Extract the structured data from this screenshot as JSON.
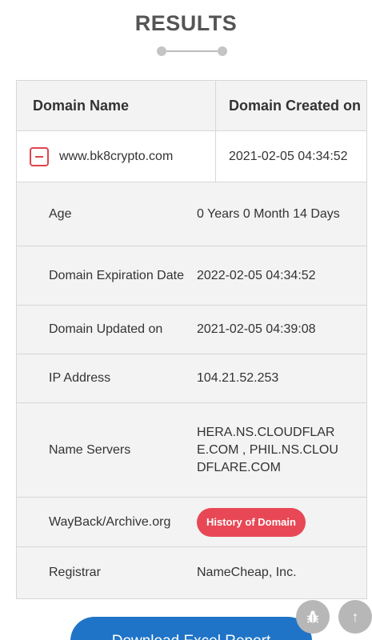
{
  "page": {
    "title": "RESULTS"
  },
  "table": {
    "headers": {
      "domain_name": "Domain Name",
      "created_on": "Domain Created on"
    },
    "domain": {
      "name": "www.bk8crypto.com",
      "created": "2021-02-05 04:34:52"
    },
    "details": [
      {
        "label": "Age",
        "value": "0 Years 0 Month 14 Days"
      },
      {
        "label": "Domain Expiration Date",
        "value": "2022-02-05 04:34:52"
      },
      {
        "label": "Domain Updated on",
        "value": "2021-02-05 04:39:08"
      },
      {
        "label": "IP Address",
        "value": "104.21.52.253"
      },
      {
        "label": "Name Servers",
        "value": "HERA.NS.CLOUDFLARE.COM , PHIL.NS.CLOUDFLARE.COM"
      },
      {
        "label": "WayBack/Archive.org",
        "button": "History of Domain"
      },
      {
        "label": "Registrar",
        "value": "NameCheap, Inc."
      }
    ]
  },
  "actions": {
    "download": "Download Excel Report"
  },
  "icons": {
    "bug": "bug-icon",
    "scroll_top": "arrow-up-icon"
  },
  "colors": {
    "accent_red": "#e84855",
    "primary_blue": "#1f74c7"
  }
}
